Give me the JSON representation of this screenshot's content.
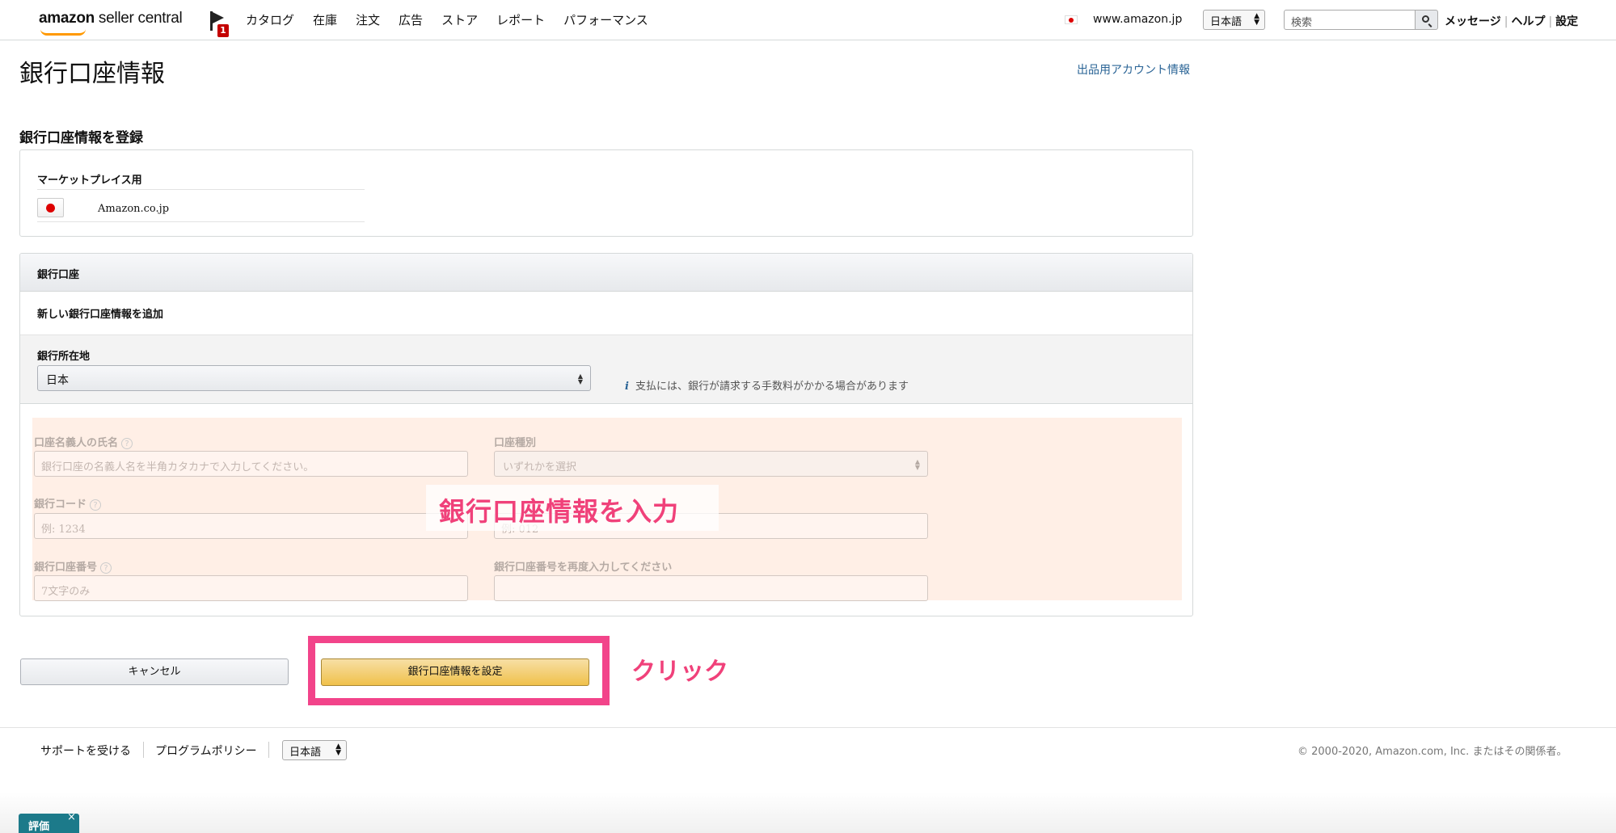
{
  "header": {
    "logo_bold": "amazon",
    "logo_rest": " seller central",
    "notification_count": "1",
    "nav": [
      "カタログ",
      "在庫",
      "注文",
      "広告",
      "ストア",
      "レポート",
      "パフォーマンス"
    ],
    "domain": "www.amazon.jp",
    "language": "日本語",
    "search_placeholder": "検索",
    "links": [
      "メッセージ",
      "ヘルプ",
      "設定"
    ]
  },
  "page": {
    "title": "銀行口座情報",
    "account_link": "出品用アカウント情報",
    "section_title": "銀行口座情報を登録"
  },
  "marketplace": {
    "label": "マーケットプレイス用",
    "name": "Amazon.co.jp"
  },
  "bank": {
    "header": "銀行口座",
    "new_account": "新しい銀行口座情報を追加",
    "location_label": "銀行所在地",
    "location_value": "日本",
    "fee_note": "支払には、銀行が請求する手数料がかかる場合があります",
    "form": {
      "holder_label": "口座名義人の氏名",
      "holder_placeholder": "銀行口座の名義人名を半角カタカナで入力してください。",
      "type_label": "口座種別",
      "type_value": "いずれかを選択",
      "code_label": "銀行コード",
      "code_placeholder": "例: 1234",
      "branch_placeholder": "例: 012",
      "number_label": "銀行口座番号",
      "number_placeholder": "7文字のみ",
      "confirm_label": "銀行口座番号を再度入力してください"
    }
  },
  "annotation": {
    "input_label": "銀行口座情報を入力",
    "click_label": "クリック"
  },
  "buttons": {
    "cancel": "キャンセル",
    "submit": "銀行口座情報を設定"
  },
  "footer": {
    "support": "サポートを受ける",
    "policy": "プログラムポリシー",
    "language": "日本語",
    "copyright": "© 2000-2020, Amazon.com, Inc. またはその関係者。"
  },
  "feedback": {
    "label": "評価",
    "close": "×"
  },
  "colors": {
    "accent": "#f0417a",
    "highlight": "#f2448a",
    "link": "#2a6496",
    "submit": "#f0c14b"
  }
}
